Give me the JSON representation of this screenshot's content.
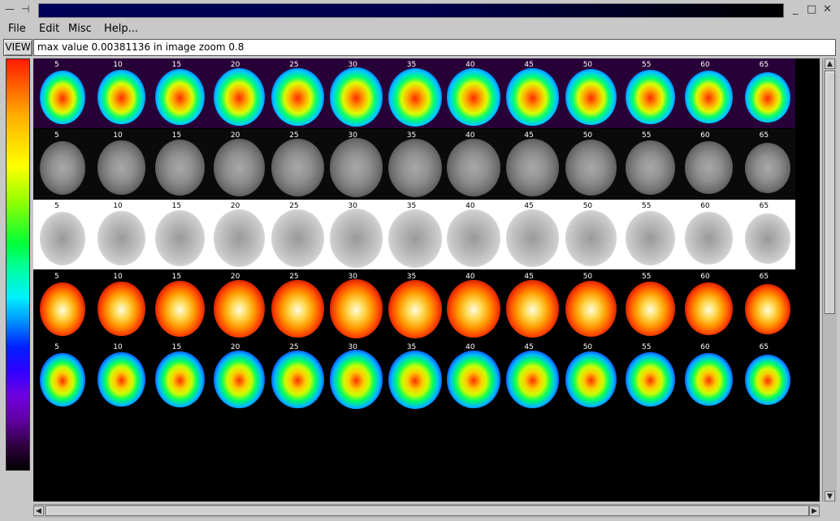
{
  "titlebar": {
    "minimize_glyph": "—",
    "pin_glyph": "⊣",
    "min_btn": "_",
    "max_btn": "□",
    "close_btn": "✕"
  },
  "menu": {
    "items": [
      {
        "label": "File"
      },
      {
        "label": "Edit"
      },
      {
        "label": "Misc"
      },
      {
        "label": "Help..."
      }
    ]
  },
  "view": {
    "button_label": "VIEW",
    "status_text": "max value 0.00381136 in image zoom 0.8"
  },
  "slices": {
    "labels": [
      "5",
      "10",
      "15",
      "20",
      "25",
      "30",
      "35",
      "40",
      "45",
      "50",
      "55",
      "60",
      "65"
    ]
  },
  "panels": [
    {
      "name": "rainbow-panel",
      "colormap": "rainbow"
    },
    {
      "name": "gray-panel",
      "colormap": "gray"
    },
    {
      "name": "inverted-gray-panel",
      "colormap": "inverted-gray"
    },
    {
      "name": "hot-panel",
      "colormap": "hot"
    },
    {
      "name": "rainbow-dark-panel",
      "colormap": "rainbow-dark"
    }
  ],
  "scroll": {
    "up": "▲",
    "down": "▼",
    "left": "◀",
    "right": "▶"
  }
}
